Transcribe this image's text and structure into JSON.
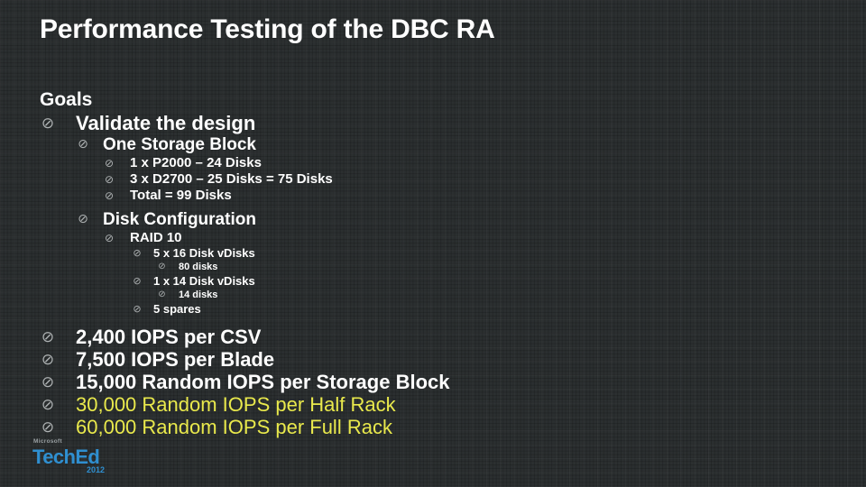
{
  "slide": {
    "title": "Performance Testing of the DBC RA",
    "bullet_glyph": "⊘",
    "colors": {
      "background": "#2b2f30",
      "grid_line": "#3a3f40",
      "text": "#ffffff",
      "accent_yellow": "#e9e94c",
      "logo_blue": "#2f8fd0",
      "logo_gray": "#9aa0a3"
    },
    "outline": [
      {
        "level": 0,
        "text": "Goals"
      },
      {
        "level": 1,
        "text": "Validate the design"
      },
      {
        "level": 2,
        "text": "One Storage Block"
      },
      {
        "level": 3,
        "text": "1 x P2000 – 24 Disks"
      },
      {
        "level": 3,
        "text": "3 x D2700 – 25 Disks = 75 Disks"
      },
      {
        "level": 3,
        "text": "Total = 99 Disks"
      },
      {
        "level": 2,
        "text": "Disk Configuration"
      },
      {
        "level": 3,
        "text": "RAID 10"
      },
      {
        "level": 4,
        "text": "5 x 16 Disk vDisks"
      },
      {
        "level": 5,
        "text": "80 disks"
      },
      {
        "level": 4,
        "text": "1 x 14 Disk vDisks"
      },
      {
        "level": 5,
        "text": "14 disks"
      },
      {
        "level": 4,
        "text": "5 spares"
      },
      {
        "level": 1,
        "text": "2,400 IOPS per CSV"
      },
      {
        "level": 1,
        "text": "7,500 IOPS per Blade"
      },
      {
        "level": 1,
        "text": "15,000 Random IOPS per Storage Block"
      },
      {
        "level": 1,
        "text": "30,000 Random IOPS per Half Rack",
        "accent": true
      },
      {
        "level": 1,
        "text": "60,000 Random IOPS per Full Rack",
        "accent": true
      }
    ]
  },
  "logo": {
    "brand_prefix": "Microsoft",
    "brand_name": "Tech",
    "brand_name_bold": "Ed",
    "year": "2012"
  }
}
